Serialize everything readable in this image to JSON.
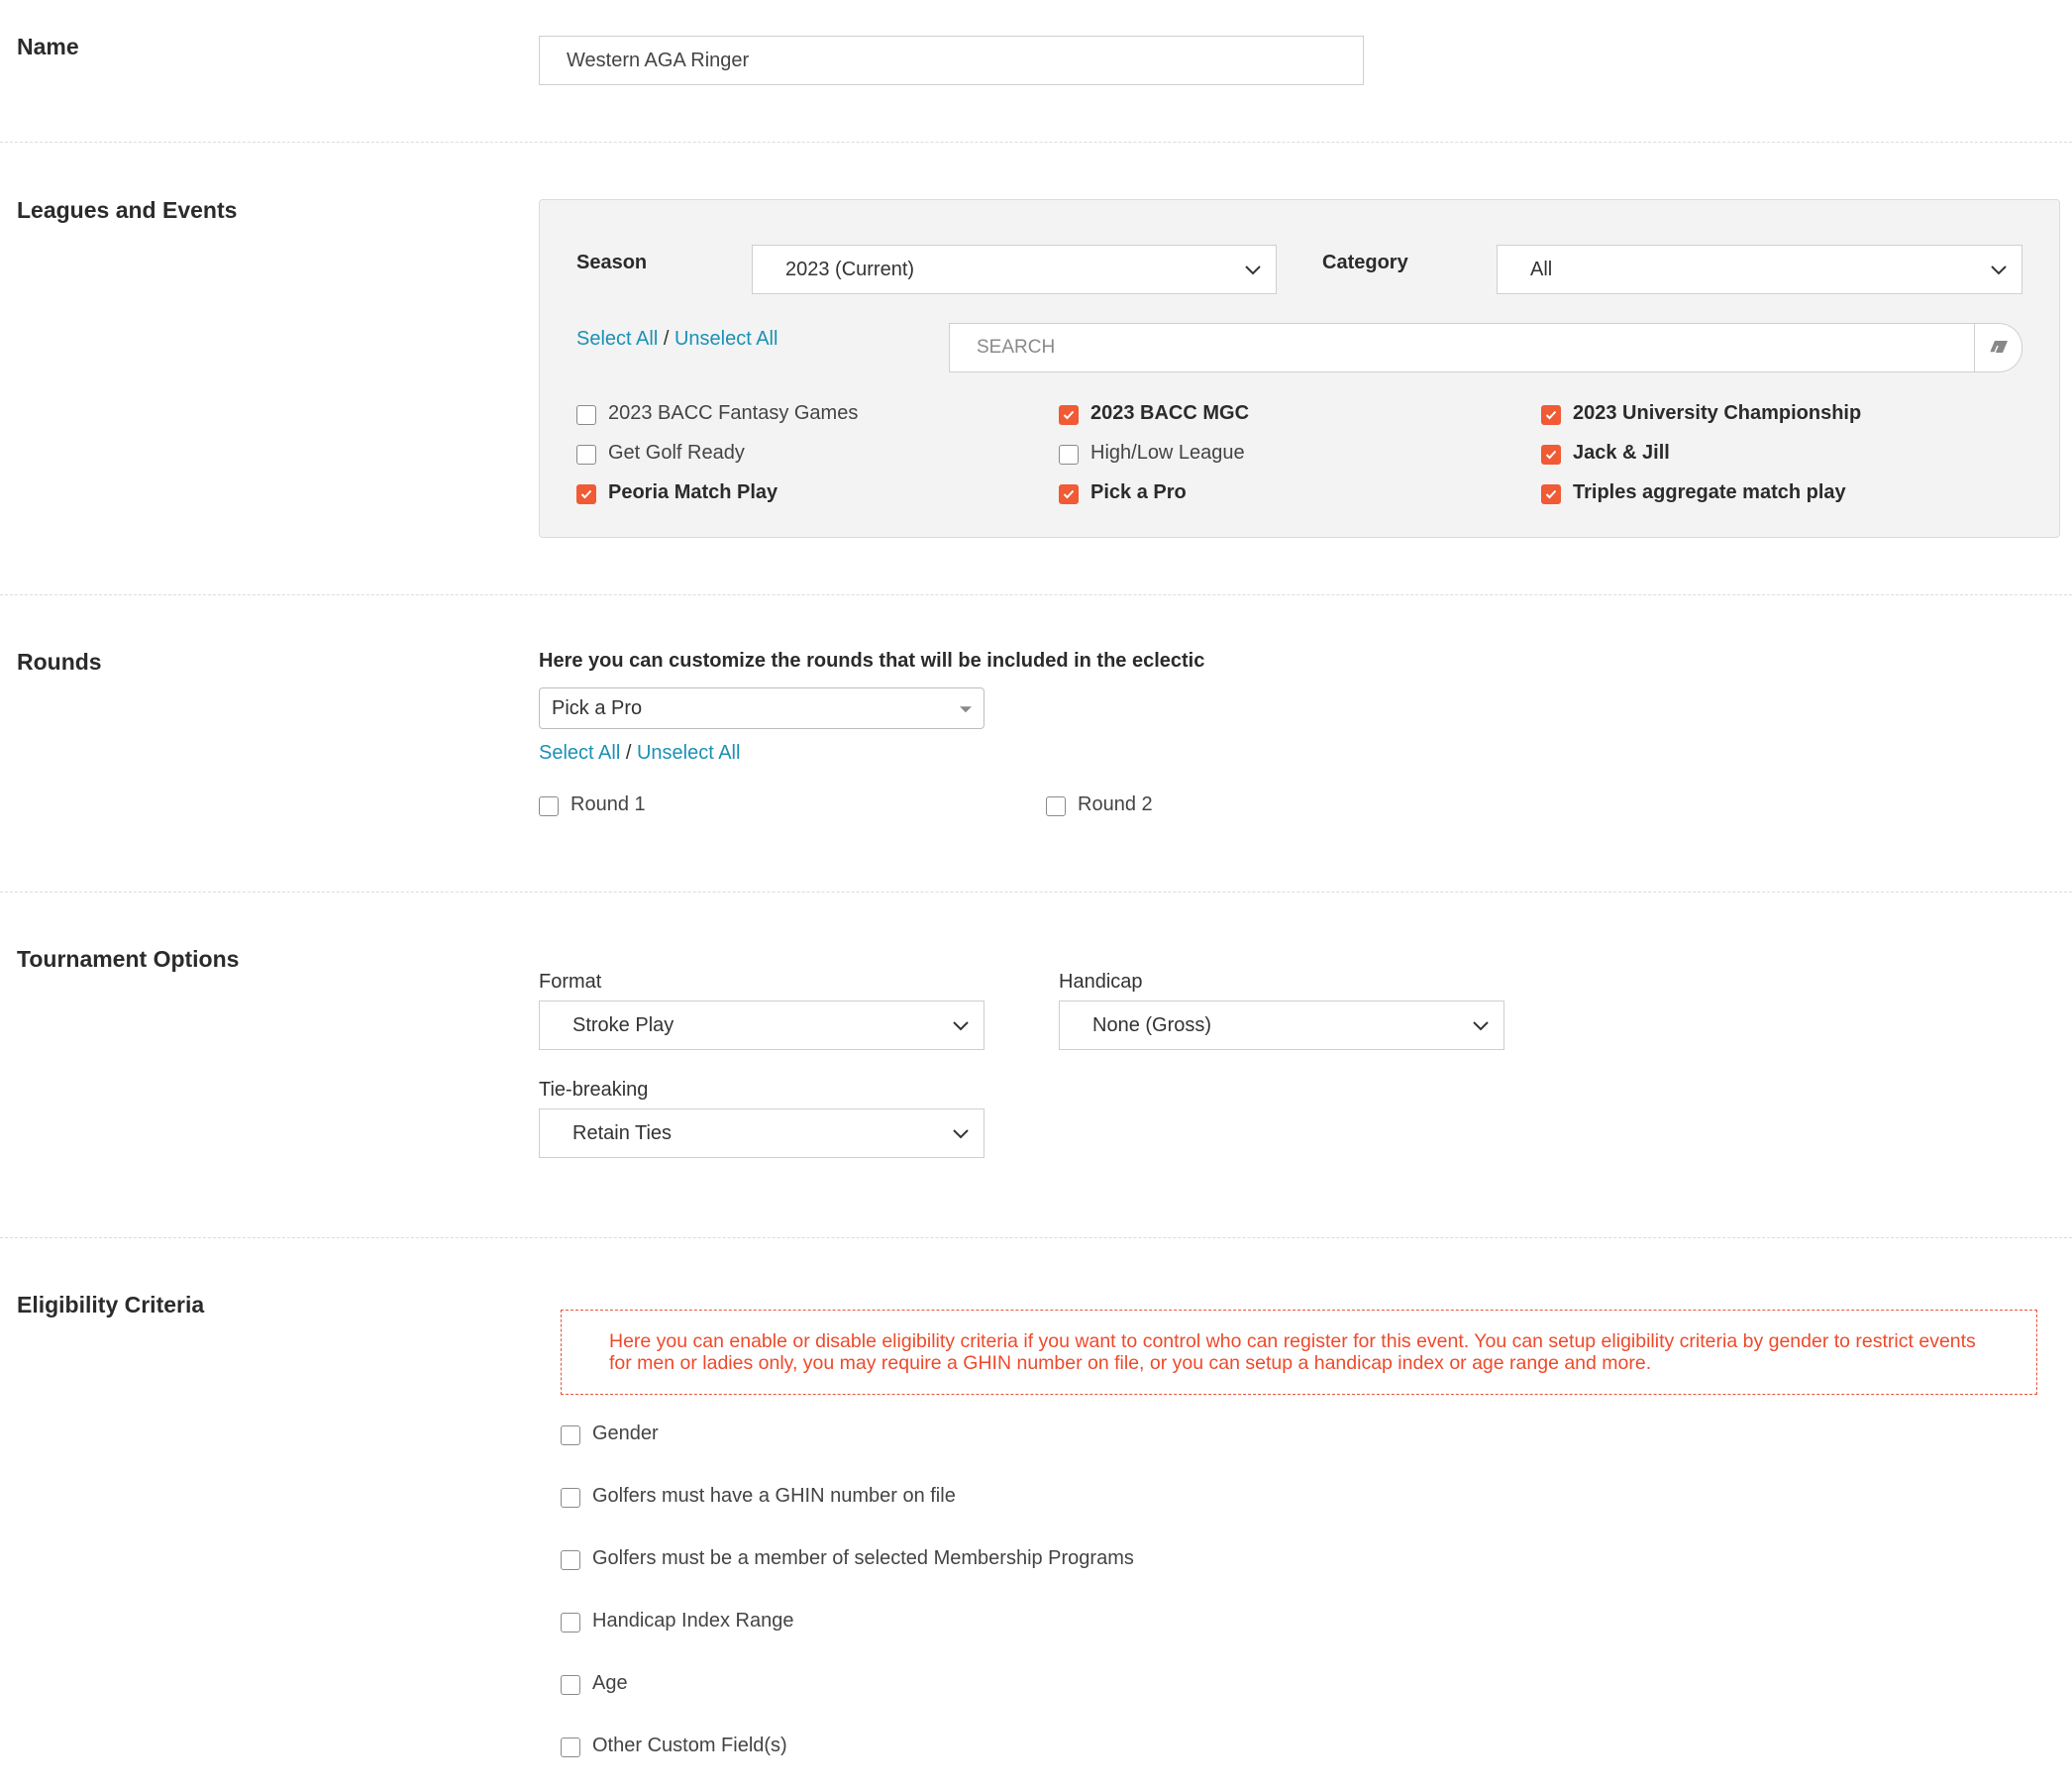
{
  "name_section": {
    "label": "Name",
    "value": "Western AGA Ringer"
  },
  "leagues_section": {
    "label": "Leagues and Events",
    "season_label": "Season",
    "season_value": "2023 (Current)",
    "category_label": "Category",
    "category_value": "All",
    "select_all": "Select All",
    "separator": "/",
    "unselect_all": "Unselect All",
    "search_placeholder": "SEARCH",
    "events": [
      {
        "label": "2023 BACC Fantasy Games",
        "checked": false
      },
      {
        "label": "2023 BACC MGC",
        "checked": true
      },
      {
        "label": "2023 University Championship",
        "checked": true
      },
      {
        "label": "Get Golf Ready",
        "checked": false
      },
      {
        "label": "High/Low League",
        "checked": false
      },
      {
        "label": "Jack & Jill",
        "checked": true
      },
      {
        "label": "Peoria Match Play",
        "checked": true
      },
      {
        "label": "Pick a Pro",
        "checked": true
      },
      {
        "label": "Triples aggregate match play",
        "checked": true
      }
    ]
  },
  "rounds_section": {
    "label": "Rounds",
    "heading": "Here you can customize the rounds that will be included in the eclectic",
    "event_select": "Pick a Pro",
    "select_all": "Select All",
    "separator": "/",
    "unselect_all": "Unselect All",
    "rounds": [
      {
        "label": "Round 1",
        "checked": false
      },
      {
        "label": "Round 2",
        "checked": false
      }
    ]
  },
  "tournament_section": {
    "label": "Tournament Options",
    "format_label": "Format",
    "format_value": "Stroke Play",
    "handicap_label": "Handicap",
    "handicap_value": "None (Gross)",
    "tiebreak_label": "Tie-breaking",
    "tiebreak_value": "Retain Ties"
  },
  "eligibility_section": {
    "label": "Eligibility Criteria",
    "notice": "Here you can enable or disable eligibility criteria if you want to control who can register for this event. You can setup eligibility criteria by gender to restrict events for men or ladies only, you may require a GHIN number on file, or you can setup a handicap index or age range and more.",
    "criteria": [
      {
        "label": "Gender",
        "checked": false
      },
      {
        "label": "Golfers must have a GHIN number on file",
        "checked": false
      },
      {
        "label": "Golfers must be a member of selected Membership Programs",
        "checked": false
      },
      {
        "label": "Handicap Index Range",
        "checked": false
      },
      {
        "label": "Age",
        "checked": false
      },
      {
        "label": "Other Custom Field(s)",
        "checked": false
      }
    ]
  },
  "colors": {
    "accent_checkbox": "#f05a35",
    "link": "#1a91b5",
    "notice_text": "#ee4a2b"
  }
}
